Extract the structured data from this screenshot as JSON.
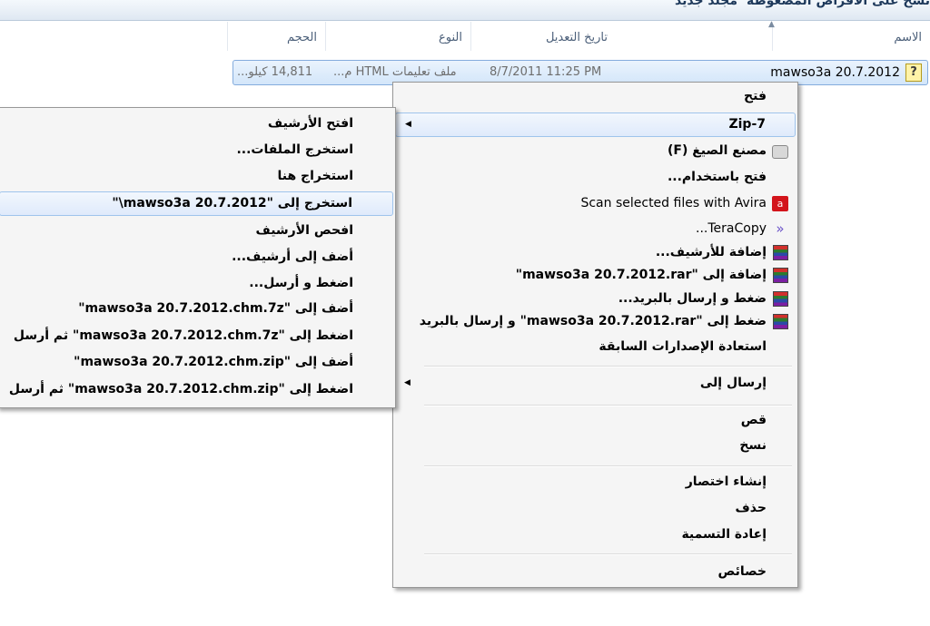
{
  "toolbar": {
    "burn_label": "نسخ على الأقراص المضغوطة",
    "new_folder_label": "مجلد جديد"
  },
  "columns": {
    "name": "الاسم",
    "date_modified": "تاريخ التعديل",
    "type": "النوع",
    "size": "الحجم"
  },
  "file": {
    "name": "mawso3a 20.7.2012",
    "date": "8/7/2011 11:25 PM",
    "type": "ملف تعليمات HTML م...",
    "size": "14,811 كيلو..."
  },
  "context_menu": {
    "open": "فتح",
    "zip7": "Zip-7",
    "format_factory": "مصنع الصيغ (F)",
    "open_with": "فتح باستخدام...",
    "avira": "Scan selected files with Avira",
    "teracopy": "TeraCopy...",
    "add_archive": "إضافة للأرشيف...",
    "add_rar": "إضافة إلى \"mawso3a 20.7.2012.rar\"",
    "compress_email": "ضغط و إرسال بالبريد...",
    "compress_rar_email": "ضغط إلى \"mawso3a 20.7.2012.rar\" و إرسال بالبريد",
    "restore_versions": "استعادة الإصدارات السابقة",
    "send_to": "إرسال إلى",
    "cut": "قص",
    "copy": "نسخ",
    "create_shortcut": "إنشاء اختصار",
    "delete": "حذف",
    "rename": "إعادة التسمية",
    "properties": "خصائص"
  },
  "submenu_7zip": {
    "open_archive": "افتح الأرشيف",
    "extract_files": "استخرج الملفات...",
    "extract_here": "استخراج هنا",
    "extract_to": "استخرج إلى \"mawso3a 20.7.2012\\\"",
    "test_archive": "افحص الأرشيف",
    "add_to_archive": "أضف إلى أرشيف...",
    "compress_email": "اضغط و أرسل...",
    "add_7z": "أضف إلى \"mawso3a 20.7.2012.chm.7z\"",
    "compress_7z_email": "اضغط إلى \"mawso3a 20.7.2012.chm.7z\" ثم أرسل",
    "add_zip": "أضف إلى \"mawso3a 20.7.2012.chm.zip\"",
    "compress_zip_email": "اضغط إلى \"mawso3a 20.7.2012.chm.zip\" ثم أرسل"
  }
}
